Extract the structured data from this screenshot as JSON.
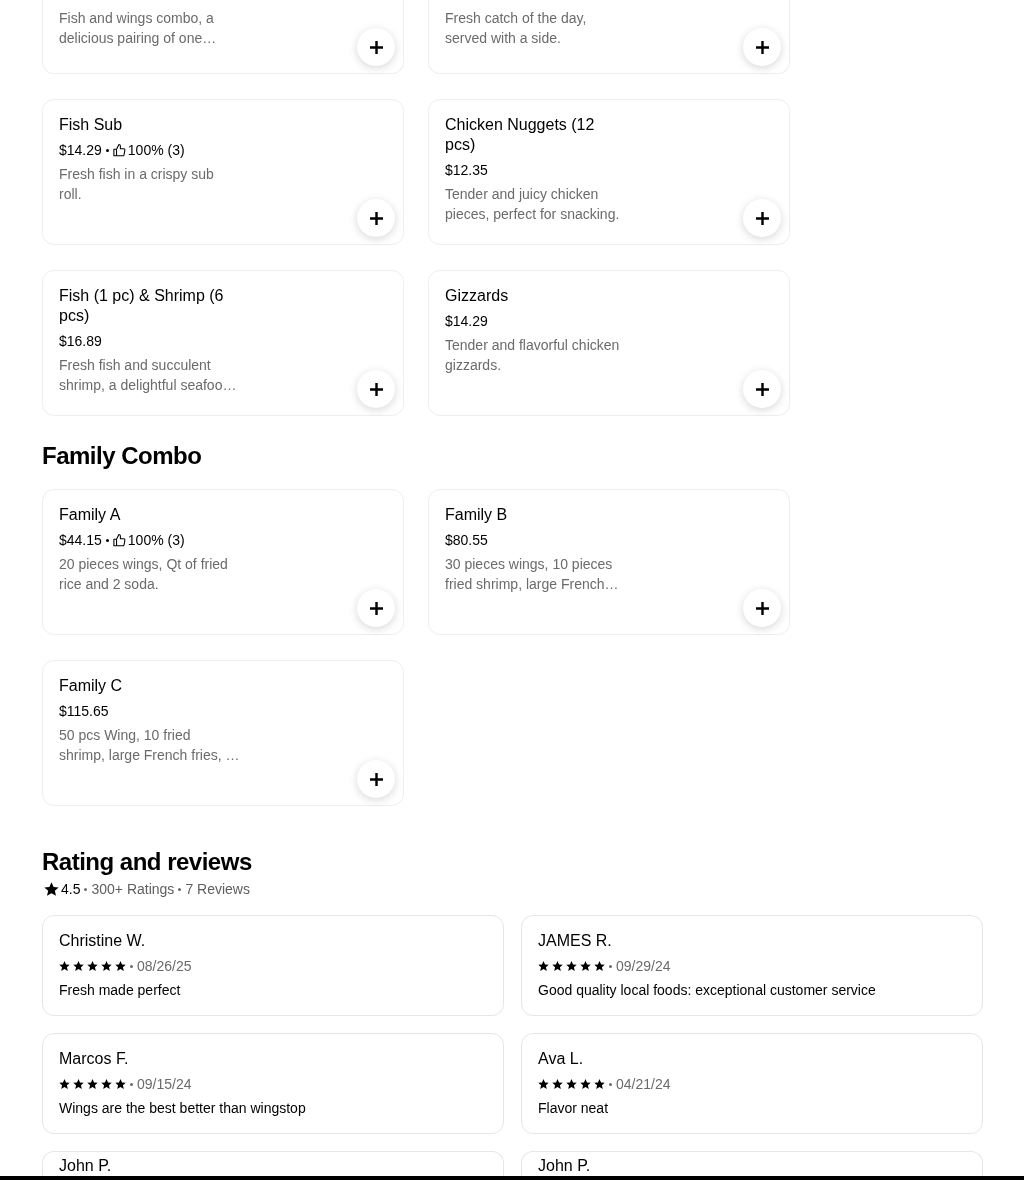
{
  "menu_sections": [
    {
      "items": [
        {
          "description": "Fish and wings combo, a\ndelicious pairing of one…"
        },
        {
          "description": "Fresh catch of the day,\nserved with a side."
        },
        {
          "title": "Fish Sub",
          "price": "$14.29",
          "rating": "100% (3)",
          "description": "Fresh fish in a crispy sub\nroll."
        },
        {
          "title": "Chicken Nuggets (12 pcs)",
          "price": "$12.35",
          "description": "Tender and juicy chicken\npieces, perfect for snacking."
        },
        {
          "title": "Fish (1 pc) & Shrimp (6 pcs)",
          "price": "$16.89",
          "description": "Fresh fish and succulent\nshrimp, a delightful seafoo…"
        },
        {
          "title": "Gizzards",
          "price": "$14.29",
          "description": "Tender and flavorful chicken\ngizzards."
        }
      ]
    },
    {
      "title": "Family Combo",
      "items": [
        {
          "title": "Family A",
          "price": "$44.15",
          "rating": "100% (3)",
          "description": "20 pieces wings, Qt of fried\nrice and 2 soda."
        },
        {
          "title": "Family B",
          "price": "$80.55",
          "description": "30 pieces wings, 10 pieces\nfried shrimp, large French…"
        },
        {
          "title": "Family C",
          "price": "$115.65",
          "description": "50 pcs Wing, 10 fried\nshrimp, large French fries, …"
        }
      ]
    }
  ],
  "reviews_section": {
    "title": "Rating and reviews",
    "rating": "4.5",
    "ratings_count": "300+ Ratings",
    "reviews_count": "7 Reviews",
    "reviews": [
      {
        "name": "Christine W.",
        "stars": 5,
        "date": "08/26/25",
        "text": "Fresh made perfect"
      },
      {
        "name": "JAMES R.",
        "stars": 5,
        "date": "09/29/24",
        "text": "Good quality local foods: exceptional customer service"
      },
      {
        "name": "Marcos F.",
        "stars": 5,
        "date": "09/15/24",
        "text": "Wings are the best better than wingstop"
      },
      {
        "name": "Ava L.",
        "stars": 5,
        "date": "04/21/24",
        "text": "Flavor neat"
      },
      {
        "name": "John P."
      },
      {
        "name": "John P."
      }
    ]
  }
}
